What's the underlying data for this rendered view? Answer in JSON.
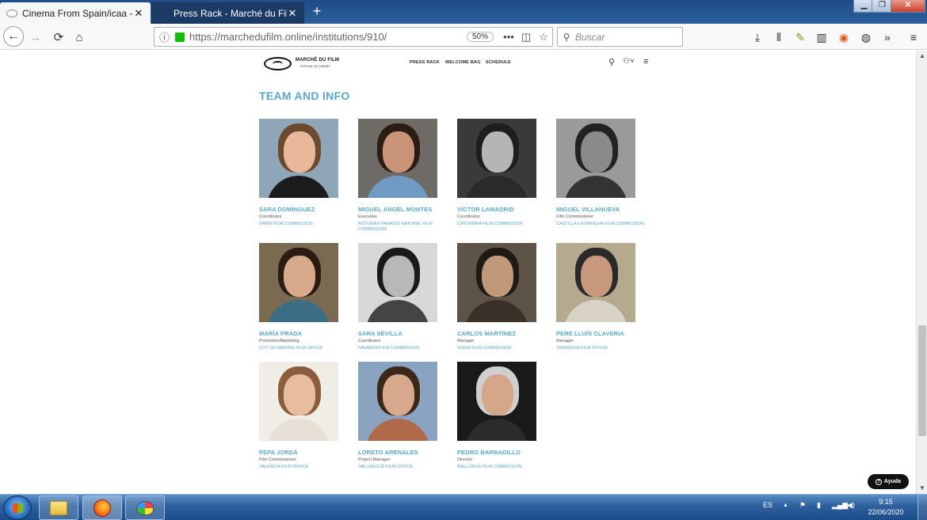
{
  "browser": {
    "tabs": [
      {
        "title": "Cinema From Spain/icaa - Mar"
      },
      {
        "title": "Press Rack - Marché du Film Or"
      }
    ],
    "window_controls": {
      "minimize": "▁",
      "maximize": "❐",
      "close": "✕"
    },
    "url": "https://marchedufilm.online/institutions/910/",
    "zoom": "50%",
    "search_placeholder": "Buscar",
    "icons": {
      "back": "←",
      "forward": "→",
      "reload": "⟳",
      "home": "⌂",
      "info": "ⓘ",
      "more": "•••",
      "pocket": "◫",
      "bookmark": "☆",
      "search": "⚲",
      "download": "⤓",
      "library": "⫴",
      "ext": "✎",
      "sidebar": "▥",
      "firefox": "◉",
      "account": "◍",
      "overflow": "»",
      "menu": "≡",
      "new_tab": "+",
      "tab_close": "✕"
    }
  },
  "site": {
    "logo_text": "MARCHÉ DU FILM",
    "logo_subtext": "FESTIVAL DE CANNES",
    "nav": [
      "PRESS RACK",
      "WELCOME BAG",
      "SCHEDULE"
    ],
    "icons": {
      "search": "⚲",
      "user": "⚇˅",
      "menu": "≡"
    },
    "section_title": "TEAM AND INFO",
    "members": [
      {
        "name": "SARA DOMÍNGUEZ",
        "role": "Coordinator",
        "org": "SPAIN FILM COMMISSION",
        "bg": "#8fa6b9",
        "hair": "#6b4a2e",
        "skin": "#e9b79a",
        "cloth": "#1c1c1c"
      },
      {
        "name": "MIGUEL ÁNGEL MONTES",
        "role": "Executive",
        "org": "ASTURIAS PARAÍSO NATURAL FILM COMMISSION",
        "bg": "#6e6a66",
        "hair": "#2b1d14",
        "skin": "#c99477",
        "cloth": "#6f9ac4"
      },
      {
        "name": "VÍCTOR LAMADRID",
        "role": "Coordinator",
        "org": "CANTABRIA FILM COMMISSION",
        "bg": "#3a3a3a",
        "hair": "#1e1e1e",
        "skin": "#b5b5b5",
        "cloth": "#2a2a2a"
      },
      {
        "name": "MIGUEL VILLANUEVA",
        "role": "Film Commissioner",
        "org": "CASTILLA-LA MANCHA FILM COMMISSION",
        "bg": "#9a9a9a",
        "hair": "#222222",
        "skin": "#8a8a8a",
        "cloth": "#333333"
      },
      {
        "name": "MARÍA PRADA",
        "role": "Promotion/Marketing",
        "org": "CITY OF MADRID FILM OFFICE",
        "bg": "#7b6a52",
        "hair": "#2a1c12",
        "skin": "#d9a98c",
        "cloth": "#3b6e84"
      },
      {
        "name": "SARA SEVILLA",
        "role": "Coordinator",
        "org": "NAVARRA FILM COMMISSION",
        "bg": "#d8d8d8",
        "hair": "#1a1a1a",
        "skin": "#b8b8b8",
        "cloth": "#444444"
      },
      {
        "name": "CARLOS MARTÍNEZ",
        "role": "Manager",
        "org": "SORIA FILM COMMISSION",
        "bg": "#5d5447",
        "hair": "#1f1a14",
        "skin": "#c0987a",
        "cloth": "#3a3028"
      },
      {
        "name": "PERE LLUÍS CLAVERIA",
        "role": "Manager",
        "org": "TERRASSA FILM OFFICE",
        "bg": "#b6aa8e",
        "hair": "#2a2a2a",
        "skin": "#c7987c",
        "cloth": "#d8d3c6"
      },
      {
        "name": "PEPA JORDÁ",
        "role": "Film Commissioner",
        "org": "VALENCIA FILM OFFICE",
        "bg": "#f0ece6",
        "hair": "#8a5e3c",
        "skin": "#e7bc9f",
        "cloth": "#e6e0d6"
      },
      {
        "name": "LORETO ARENALES",
        "role": "Project Manager",
        "org": "VALLADOLID FILM OFFICE",
        "bg": "#8aa3c0",
        "hair": "#3b2818",
        "skin": "#d8a98c",
        "cloth": "#b06a4a"
      },
      {
        "name": "PEDRO BARBADILLO",
        "role": "Director",
        "org": "MALLORCA FILM COMMISSION",
        "bg": "#1a1a1a",
        "hair": "#cfcfcf",
        "skin": "#d6a68b",
        "cloth": "#2b2b2b"
      }
    ],
    "help_button": "Ayuda",
    "help_icon": "?"
  },
  "taskbar": {
    "lang": "ES",
    "tray_icons": {
      "up": "▲",
      "flag": "⚑",
      "battery": "▮",
      "network": "▂▄▆",
      "volume": "◀)"
    },
    "time": "9:15",
    "date": "22/06/2020"
  }
}
